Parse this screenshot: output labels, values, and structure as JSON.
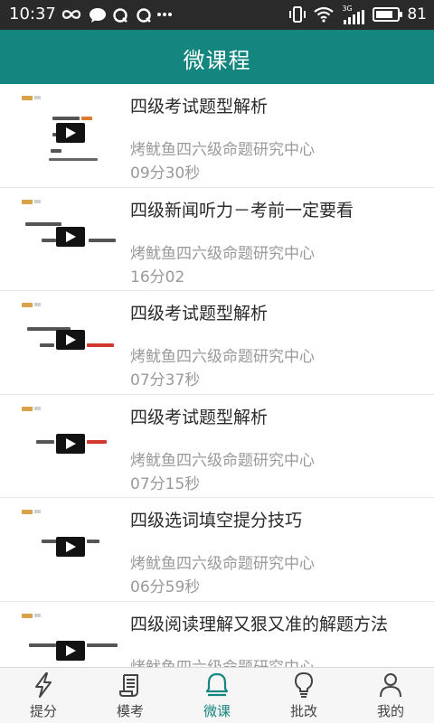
{
  "status_bar": {
    "time": "10:37",
    "network": "3G",
    "battery": "81",
    "battery_level": 0.81,
    "icons": [
      "infinity-icon",
      "chat-bubble-icon",
      "q-icon",
      "q-icon",
      "more-dots-icon",
      "vibrate-icon",
      "wifi-icon",
      "signal-icon",
      "battery-icon"
    ]
  },
  "header": {
    "title": "微课程",
    "color": "#14857f"
  },
  "courses": [
    {
      "title": "四级考试题型解析",
      "source": "烤鱿鱼四六级命题研究中心",
      "duration": "09分30秒"
    },
    {
      "title": "四级新闻听力－考前一定要看",
      "source": "烤鱿鱼四六级命题研究中心",
      "duration": "16分02"
    },
    {
      "title": "四级考试题型解析",
      "source": "烤鱿鱼四六级命题研究中心",
      "duration": "07分37秒"
    },
    {
      "title": "四级考试题型解析",
      "source": "烤鱿鱼四六级命题研究中心",
      "duration": "07分15秒"
    },
    {
      "title": "四级选词填空提分技巧",
      "source": "烤鱿鱼四六级命题研究中心",
      "duration": "06分59秒"
    },
    {
      "title": "四级阅读理解又狠又准的解题方法",
      "source": "烤鱿鱼四六级命题研究中心",
      "duration": ""
    }
  ],
  "bottom_nav": {
    "active_color": "#14857f",
    "tabs": [
      {
        "label": "提分",
        "icon": "lightning-icon",
        "active": false
      },
      {
        "label": "模考",
        "icon": "scroll-icon",
        "active": false
      },
      {
        "label": "微课",
        "icon": "bell-icon",
        "active": true
      },
      {
        "label": "批改",
        "icon": "lightbulb-icon",
        "active": false
      },
      {
        "label": "我的",
        "icon": "person-icon",
        "active": false
      }
    ]
  }
}
